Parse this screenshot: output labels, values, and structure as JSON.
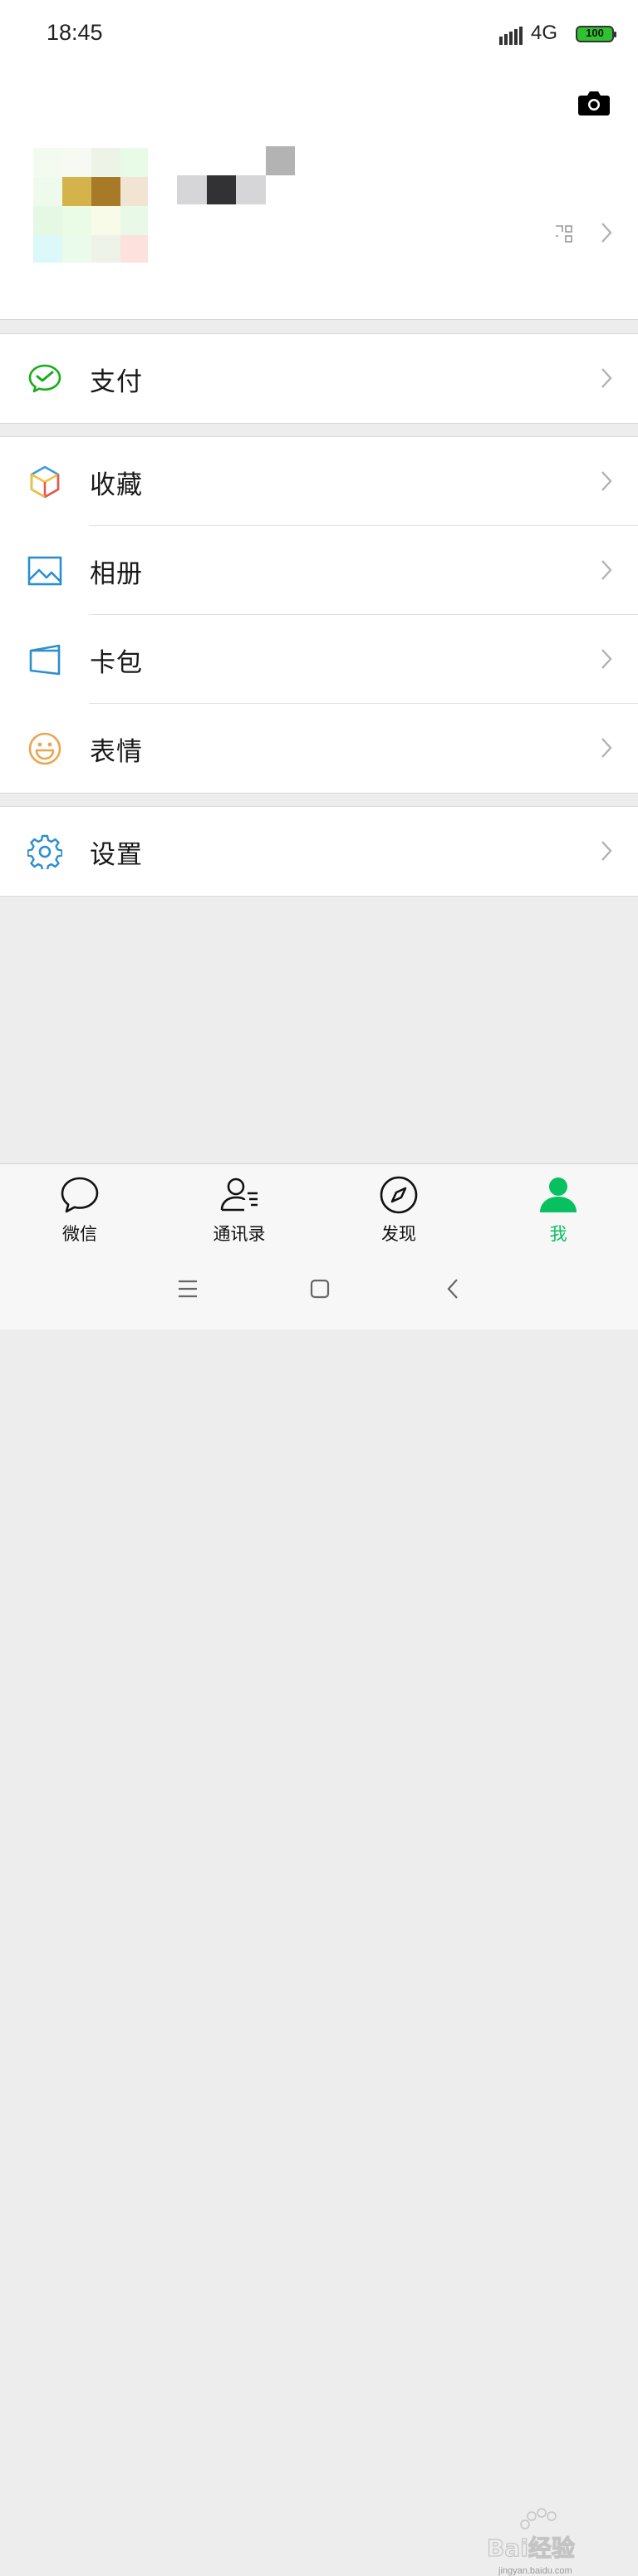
{
  "status_bar": {
    "time": "18:45",
    "network": "4G",
    "battery": "100"
  },
  "menu": {
    "pay": {
      "label": "支付",
      "icon": "wechat-pay-icon"
    },
    "favorites": {
      "label": "收藏",
      "icon": "favorites-cube-icon"
    },
    "album": {
      "label": "相册",
      "icon": "album-picture-icon"
    },
    "cards": {
      "label": "卡包",
      "icon": "card-wallet-icon"
    },
    "stickers": {
      "label": "表情",
      "icon": "smiley-icon"
    },
    "settings": {
      "label": "设置",
      "icon": "gear-icon"
    }
  },
  "tabs": [
    {
      "label": "微信",
      "icon": "chat-bubble-icon",
      "active": false
    },
    {
      "label": "通讯录",
      "icon": "contacts-icon",
      "active": false
    },
    {
      "label": "发现",
      "icon": "compass-icon",
      "active": false
    },
    {
      "label": "我",
      "icon": "person-icon",
      "active": true
    }
  ],
  "colors": {
    "accent": "#07c160",
    "background": "#ededed",
    "text": "#191919"
  },
  "watermark": {
    "text": "Bai经验",
    "url": "jingyan.baidu.com"
  }
}
